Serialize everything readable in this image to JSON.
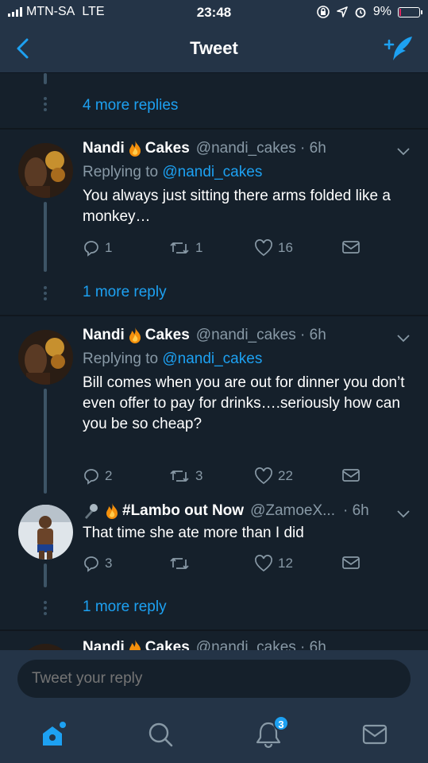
{
  "status_bar": {
    "carrier": "MTN-SA",
    "network": "LTE",
    "time": "23:48",
    "battery_percent": "9%",
    "battery_level": 0.09,
    "icons": [
      "signal-icon",
      "lock-rotation-icon",
      "location-icon",
      "alarm-icon",
      "battery-icon"
    ]
  },
  "nav": {
    "title": "Tweet",
    "back_icon": "back-chevron-icon",
    "compose_icon": "compose-tweet-icon"
  },
  "colors": {
    "accent": "#1da1f2",
    "background": "#15202b",
    "bar": "#243447",
    "muted": "#8899a6",
    "badge": "#1da1f2"
  },
  "timeline": {
    "top_more_replies": "4 more replies",
    "tweets": [
      {
        "name_part1": "Nandi",
        "name_part2": "Cakes",
        "handle_time": "@nandi_cakes · 6h",
        "replying_label": "Replying to",
        "replying_handle": "@nandi_cakes",
        "text": "You always just sitting there arms folded like a monkey…",
        "replies": "1",
        "retweets": "1",
        "likes": "16",
        "more_replies": "1 more reply"
      },
      {
        "name_part1": "Nandi",
        "name_part2": "Cakes",
        "handle_time": "@nandi_cakes · 6h",
        "replying_label": "Replying to",
        "replying_handle": "@nandi_cakes",
        "text": "Bill comes when you are out for dinner you don’t even offer to pay for drinks….seriously how can you be so cheap?",
        "replies": "2",
        "retweets": "3",
        "likes": "22"
      },
      {
        "name": "#Lambo out Now",
        "handle": "@ZamoeX...",
        "time": "· 6h",
        "text": "That time she ate more than I did",
        "replies": "3",
        "retweets": "",
        "likes": "12",
        "more_replies": "1 more reply"
      },
      {
        "name_part1": "Nandi",
        "name_part2": "Cakes",
        "handle_time": "@nandi_cakes · 6h"
      }
    ]
  },
  "reply_bar": {
    "placeholder": "Tweet your reply"
  },
  "tab_bar": {
    "tabs": [
      "home-icon",
      "search-icon",
      "notifications-icon",
      "messages-icon"
    ],
    "notification_count": "3"
  }
}
